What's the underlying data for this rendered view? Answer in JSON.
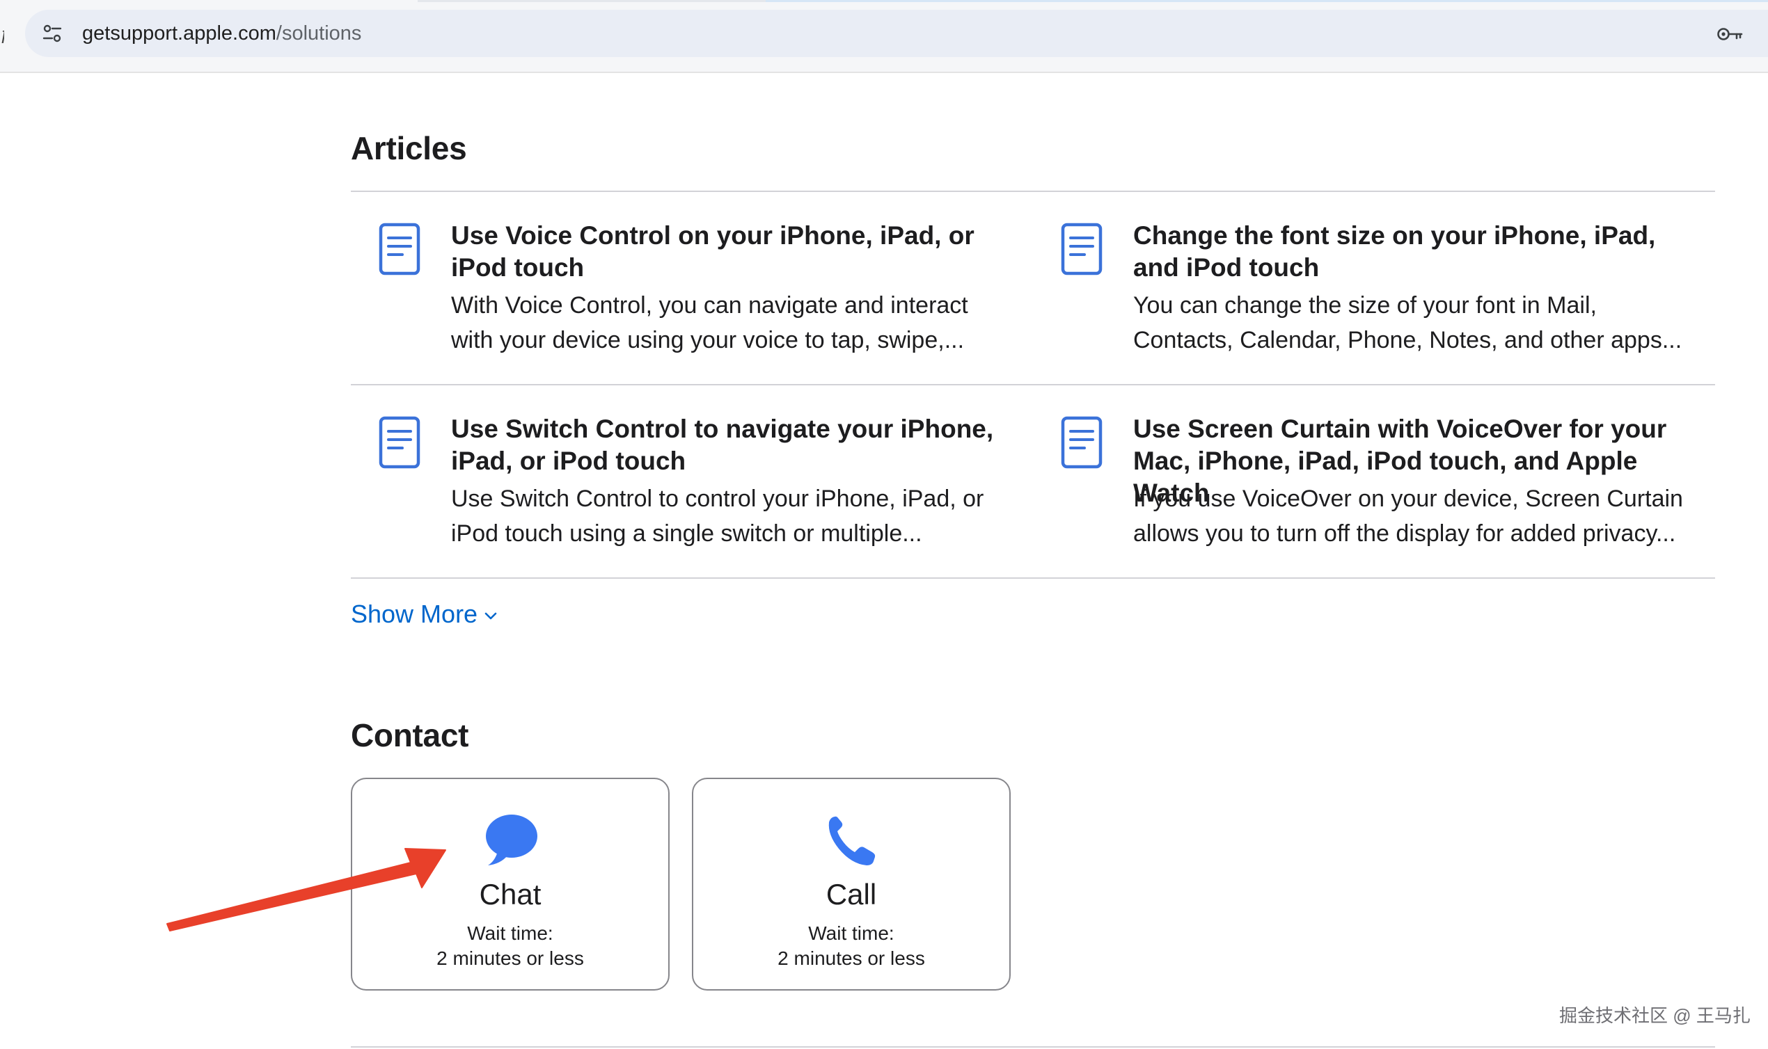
{
  "browser": {
    "url_host": "getsupport.apple.com",
    "url_path": "/solutions",
    "edge_glyph": "ƒ"
  },
  "articles": {
    "title": "Articles",
    "items": [
      {
        "title": "Use Voice Control on your iPhone, iPad, or iPod touch",
        "description": "With Voice Control, you can navigate and interact with your device using your voice to tap, swipe,..."
      },
      {
        "title": "Change the font size on your iPhone, iPad, and iPod touch",
        "description": "You can change the size of your font in Mail, Contacts, Calendar, Phone, Notes, and other apps..."
      },
      {
        "title": "Use Switch Control to navigate your iPhone, iPad, or iPod touch",
        "description": "Use Switch Control to control your iPhone, iPad, or iPod touch using a single switch or multiple..."
      },
      {
        "title": "Use Screen Curtain with VoiceOver for your Mac, iPhone, iPad, iPod touch, and Apple Watch",
        "description": "If you use VoiceOver on your device, Screen Curtain allows you to turn off the display for added privacy..."
      }
    ],
    "show_more_label": "Show More"
  },
  "contact": {
    "title": "Contact",
    "options": [
      {
        "title": "Chat",
        "wait_label": "Wait time:",
        "wait_value": "2 minutes or less",
        "icon": "chat-bubble-icon"
      },
      {
        "title": "Call",
        "wait_label": "Wait time:",
        "wait_value": "2 minutes or less",
        "icon": "phone-icon"
      }
    ]
  },
  "watermark": "掘金技术社区 @ 王马扎",
  "colors": {
    "link": "#0066cc",
    "icon_blue": "#3a78f2",
    "doc_icon": "#3b72d9",
    "annotation_red": "#e8402a",
    "divider": "#d2d2d7"
  }
}
